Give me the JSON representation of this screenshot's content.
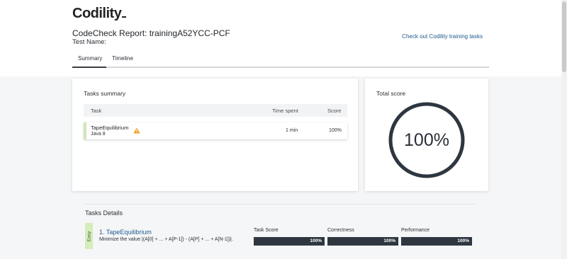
{
  "header": {
    "logo": "Codility",
    "report_title": "CodeCheck Report: trainingA52YCC-PCF",
    "test_name_label": "Test Name:",
    "training_link": "Check out Codility training tasks"
  },
  "tabs": [
    {
      "label": "Summary",
      "active": true
    },
    {
      "label": "Timeline",
      "active": false
    }
  ],
  "tasks_summary": {
    "title": "Tasks summary",
    "columns": [
      "Task",
      "Time spent",
      "Score"
    ],
    "rows": [
      {
        "name": "TapeEquilibrium",
        "language": "Java 8",
        "time": "1 min",
        "score": "100%",
        "warning_icon": "warning-triangle-icon"
      }
    ]
  },
  "total_score": {
    "title": "Total score",
    "value": "100%",
    "fraction": 1.0
  },
  "tasks_details": {
    "title": "Tasks Details",
    "items": [
      {
        "difficulty": "Easy",
        "title": "1. TapeEquilibrium",
        "description": "Minimize the value |(A[0] + ... + A[P-1]) - (A[P] + ... + A[N-1])|.",
        "metrics": [
          {
            "label": "Task Score",
            "value": "100%",
            "fraction": 1.0
          },
          {
            "label": "Correctness",
            "value": "100%",
            "fraction": 1.0
          },
          {
            "label": "Performance",
            "value": "100%",
            "fraction": 1.0
          }
        ]
      }
    ]
  },
  "colors": {
    "accent_link": "#1e5a8e",
    "easy_badge": "#d4edbb",
    "bar_fill": "#2e3640"
  }
}
